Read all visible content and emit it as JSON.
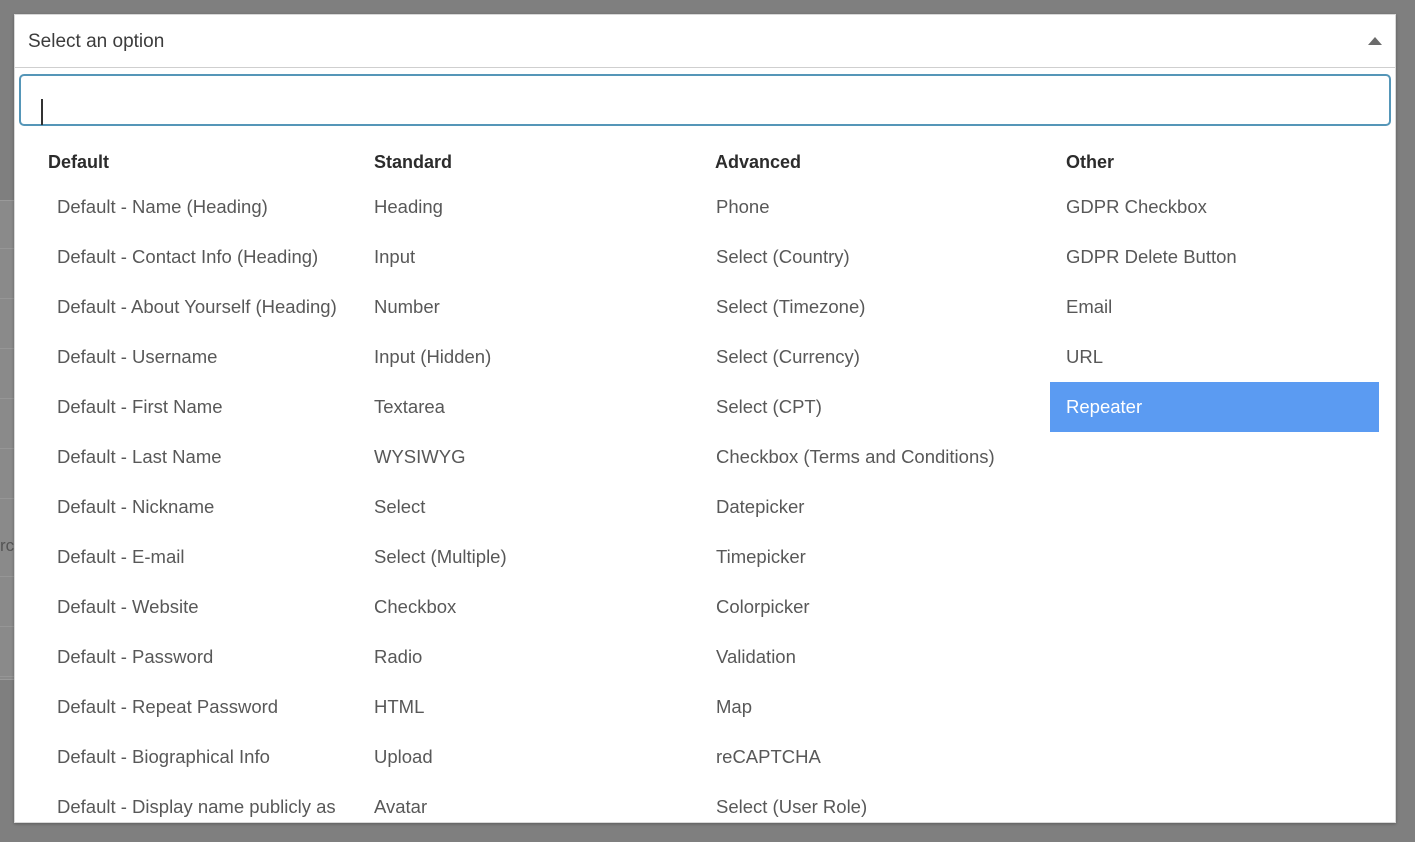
{
  "dropdown": {
    "header_label": "Select an option",
    "caret_icon": "triangle-up-icon",
    "search": {
      "value": "",
      "placeholder": ""
    },
    "colors": {
      "selected_background": "#5b9bf2",
      "selected_text": "#ffffff",
      "focus_border": "#5596b8",
      "option_text": "#585858",
      "group_label_text": "#2c2c2c",
      "panel_background": "#ffffff",
      "page_backdrop": "#7f7f7f"
    },
    "groups": [
      {
        "label": "Default",
        "items": [
          "Default - Name (Heading)",
          "Default - Contact Info (Heading)",
          "Default - About Yourself (Heading)",
          "Default - Username",
          "Default - First Name",
          "Default - Last Name",
          "Default - Nickname",
          "Default - E-mail",
          "Default - Website",
          "Default - Password",
          "Default - Repeat Password",
          "Default - Biographical Info",
          "Default - Display name publicly as"
        ],
        "selected_index": null
      },
      {
        "label": "Standard",
        "items": [
          "Heading",
          "Input",
          "Number",
          "Input (Hidden)",
          "Textarea",
          "WYSIWYG",
          "Select",
          "Select (Multiple)",
          "Checkbox",
          "Radio",
          "HTML",
          "Upload",
          "Avatar"
        ],
        "selected_index": null
      },
      {
        "label": "Advanced",
        "items": [
          "Phone",
          "Select (Country)",
          "Select (Timezone)",
          "Select (Currency)",
          "Select (CPT)",
          "Checkbox (Terms and Conditions)",
          "Datepicker",
          "Timepicker",
          "Colorpicker",
          "Validation",
          "Map",
          "reCAPTCHA",
          "Select (User Role)"
        ],
        "selected_index": null
      },
      {
        "label": "Other",
        "items": [
          "GDPR Checkbox",
          "GDPR Delete Button",
          "Email",
          "URL",
          "Repeater"
        ],
        "selected_index": 4
      }
    ]
  },
  "background_page": {
    "visible_text_fragment": "rc"
  }
}
